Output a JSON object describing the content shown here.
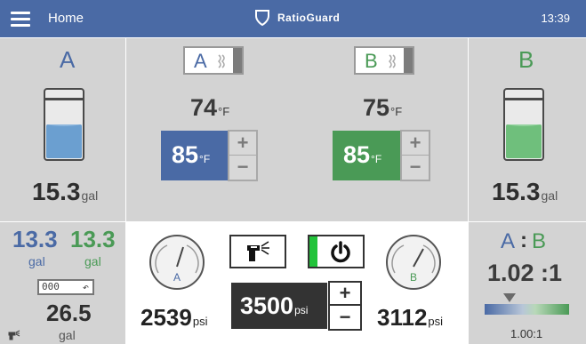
{
  "header": {
    "menu_icon": "hamburger-menu-icon",
    "home_label": "Home",
    "brand": "RatioGuard",
    "brand_icon": "shield-icon",
    "time": "13:39"
  },
  "colors": {
    "header_bg": "#4a6aa5",
    "material_a": "#4a6aa5",
    "material_b": "#4a9a56",
    "panel_bg": "#d3d3d3"
  },
  "material_a": {
    "label": "A",
    "tank_level": "15.3",
    "tank_unit": "gal",
    "fill_fraction": 0.55,
    "heater_label": "A",
    "actual_temp": "74",
    "temp_unit": "°F",
    "set_temp": "85",
    "set_unit": "°F"
  },
  "material_b": {
    "label": "B",
    "tank_level": "15.3",
    "tank_unit": "gal",
    "fill_fraction": 0.55,
    "heater_label": "B",
    "actual_temp": "75",
    "temp_unit": "°F",
    "set_temp": "85",
    "set_unit": "°F"
  },
  "usage": {
    "a_value": "13.3",
    "a_unit": "gal",
    "b_value": "13.3",
    "b_unit": "gal",
    "counter": "000",
    "reset_icon": "reset-arrow-icon",
    "total_value": "26.5",
    "total_unit": "gal",
    "dispense_icon": "spray-gun-icon"
  },
  "pressure": {
    "a_label": "A",
    "a_value": "2539",
    "a_unit": "psi",
    "b_label": "B",
    "b_value": "3112",
    "b_unit": "psi",
    "set_value": "3500",
    "set_unit": "psi",
    "gun_icon": "spray-gun-icon",
    "power_icon": "power-icon"
  },
  "ratio": {
    "label_a": "A",
    "separator": ":",
    "label_b": "B",
    "value": "1.02 :1",
    "target": "1.00:1"
  }
}
